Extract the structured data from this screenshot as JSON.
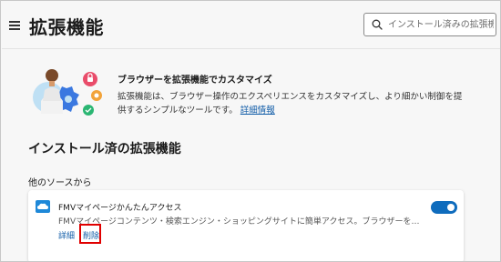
{
  "header": {
    "title": "拡張機能",
    "search_placeholder": "インストール済みの拡張機..."
  },
  "promo": {
    "title": "ブラウザーを拡張機能でカスタマイズ",
    "description": "拡張機能は、ブラウザー操作のエクスペリエンスをカスタマイズし、より細かい制御を提供するシンプルなツールです。",
    "learn_more": "詳細情報"
  },
  "installed": {
    "section_title": "インストール済の拡張機能",
    "source_label": "他のソースから",
    "extensions": [
      {
        "name": "FMVマイページかんたんアクセス",
        "description": "FMVマイページコンテンツ・検索エンジン・ショッピングサイトに簡単アクセス。ブラウザーを起動するたびに、FMVマイページコンテ...",
        "enabled": true,
        "details_label": "詳細",
        "remove_label": "削除"
      }
    ]
  },
  "colors": {
    "accent": "#0f6cbd",
    "link": "#0f5ba7",
    "highlight": "#e00000",
    "background": "#f7f7f7"
  },
  "icons": [
    "hamburger-menu-icon",
    "search-icon",
    "extension-cloud-icon"
  ]
}
